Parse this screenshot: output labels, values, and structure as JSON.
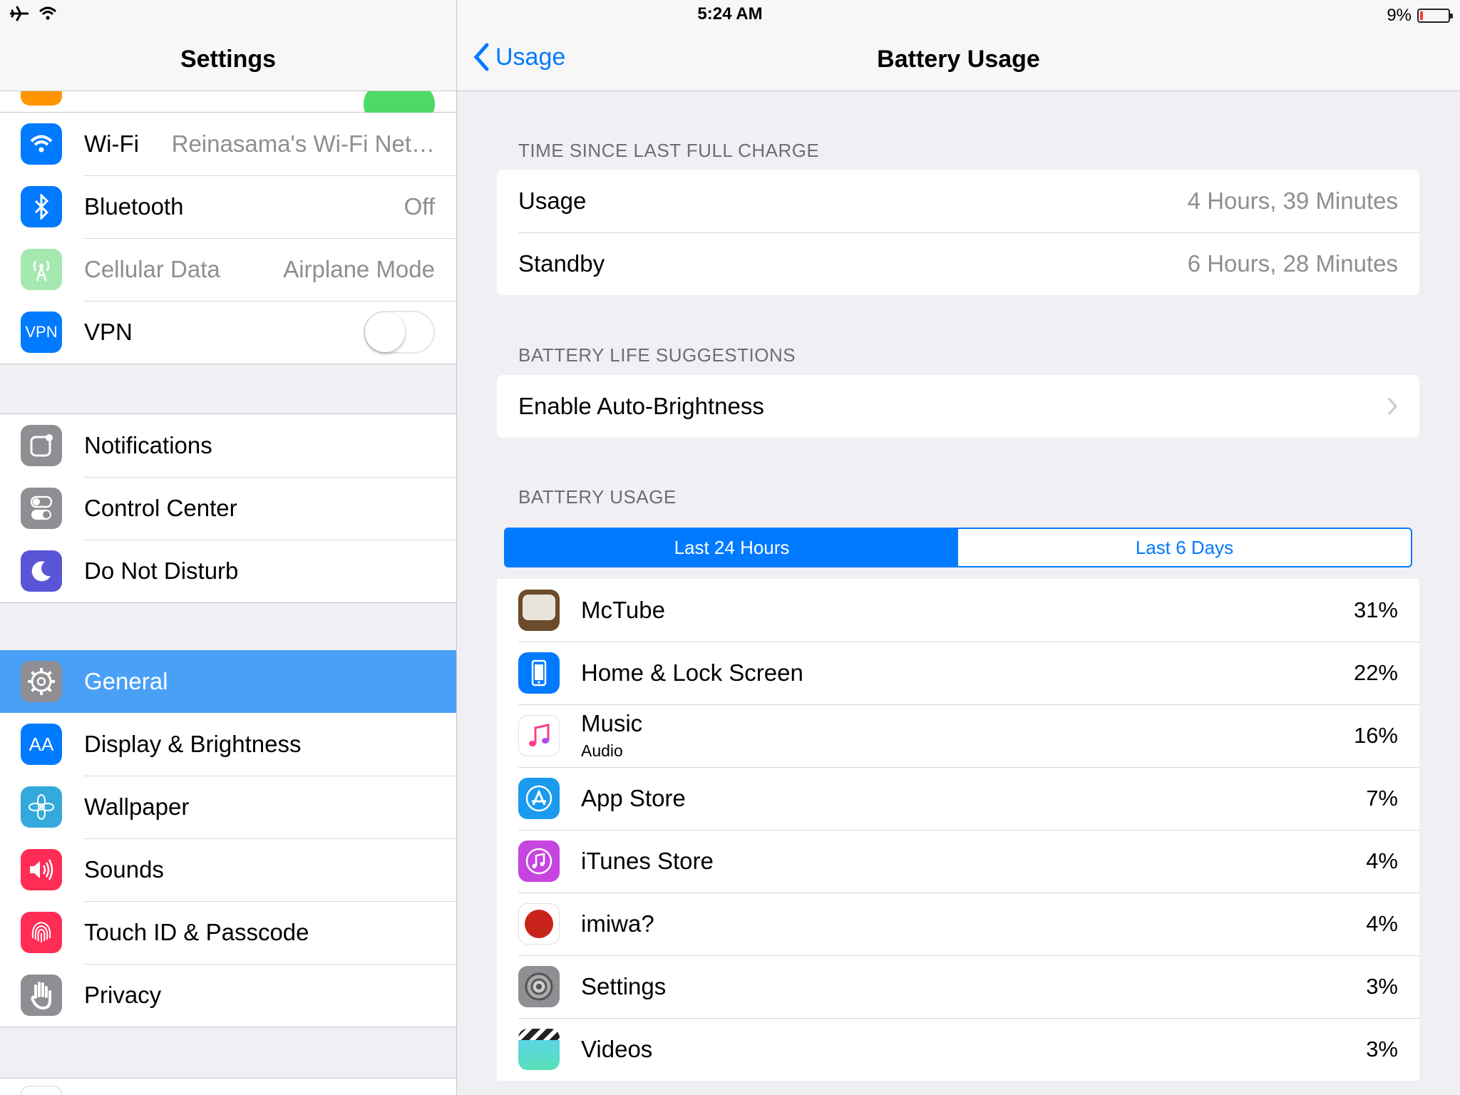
{
  "status": {
    "time": "5:24 AM",
    "battery": "9%"
  },
  "left": {
    "title": "Settings",
    "group1": [
      {
        "label": "Wi-Fi",
        "value": "Reinasama's Wi-Fi Net…"
      },
      {
        "label": "Bluetooth",
        "value": "Off"
      },
      {
        "label": "Cellular Data",
        "value": "Airplane Mode"
      },
      {
        "label": "VPN",
        "icon_text": "VPN"
      }
    ],
    "group2": [
      {
        "label": "Notifications"
      },
      {
        "label": "Control Center"
      },
      {
        "label": "Do Not Disturb"
      }
    ],
    "group3": [
      {
        "label": "General"
      },
      {
        "label": "Display & Brightness",
        "icon_text": "AA"
      },
      {
        "label": "Wallpaper"
      },
      {
        "label": "Sounds"
      },
      {
        "label": "Touch ID & Passcode"
      },
      {
        "label": "Privacy"
      }
    ]
  },
  "right": {
    "back_label": "Usage",
    "title": "Battery Usage",
    "time_header": "TIME SINCE LAST FULL CHARGE",
    "time_rows": [
      {
        "label": "Usage",
        "value": "4 Hours, 39 Minutes"
      },
      {
        "label": "Standby",
        "value": "6 Hours, 28 Minutes"
      }
    ],
    "suggest_header": "BATTERY LIFE SUGGESTIONS",
    "suggestion": "Enable Auto-Brightness",
    "usage_header": "BATTERY USAGE",
    "segments": [
      "Last 24 Hours",
      "Last 6 Days"
    ],
    "apps": [
      {
        "name": "McTube",
        "pct": "31%"
      },
      {
        "name": "Home & Lock Screen",
        "pct": "22%"
      },
      {
        "name": "Music",
        "sub": "Audio",
        "pct": "16%"
      },
      {
        "name": "App Store",
        "pct": "7%"
      },
      {
        "name": "iTunes Store",
        "pct": "4%"
      },
      {
        "name": "imiwa?",
        "pct": "4%"
      },
      {
        "name": "Settings",
        "pct": "3%"
      },
      {
        "name": "Videos",
        "pct": "3%"
      }
    ]
  },
  "colors": {
    "accent": "#007aff",
    "selected_row": "#4aa0f7",
    "toggle_on": "#4cd964",
    "battery_low": "#ff3b30"
  }
}
